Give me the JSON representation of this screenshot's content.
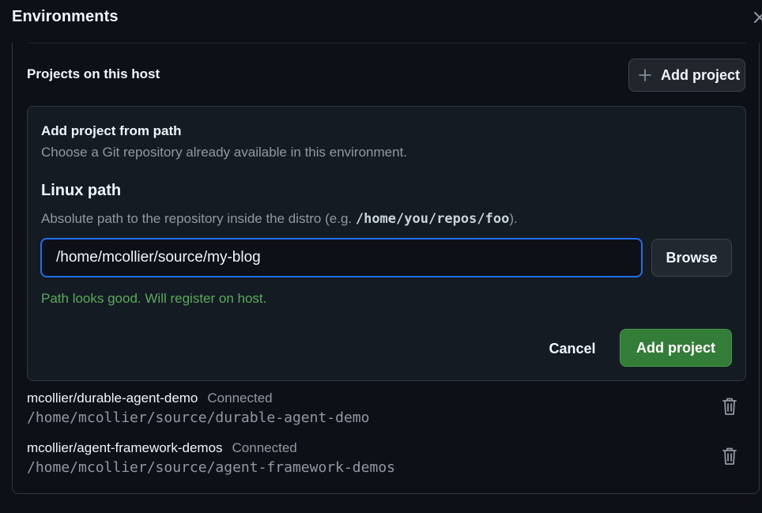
{
  "dialog": {
    "title": "Environments"
  },
  "projects_section": {
    "title": "Projects on this host",
    "add_button_label": "Add project"
  },
  "add_form": {
    "heading": "Add project from path",
    "subheading": "Choose a Git repository already available in this environment.",
    "field_label": "Linux path",
    "help_prefix": "Absolute path to the repository inside the distro (e.g. ",
    "help_example": "/home/you/repos/foo",
    "help_suffix": ").",
    "path_value": "/home/mcollier/source/my-blog",
    "browse_label": "Browse",
    "validation_message": "Path looks good. Will register on host.",
    "cancel_label": "Cancel",
    "submit_label": "Add project"
  },
  "projects": [
    {
      "name": "mcollier/durable-agent-demo",
      "status": "Connected",
      "path": "/home/mcollier/source/durable-agent-demo"
    },
    {
      "name": "mcollier/agent-framework-demos",
      "status": "Connected",
      "path": "/home/mcollier/source/agent-framework-demos"
    }
  ],
  "icons": {
    "close": "close-icon",
    "add": "plus-icon",
    "delete": "trash-icon"
  },
  "colors": {
    "background": "#0d1117",
    "card": "#151b23",
    "focus_border": "#1f6feb",
    "primary_button": "#347d39",
    "success_text": "#57ab5a",
    "muted_text": "#9198a1"
  }
}
